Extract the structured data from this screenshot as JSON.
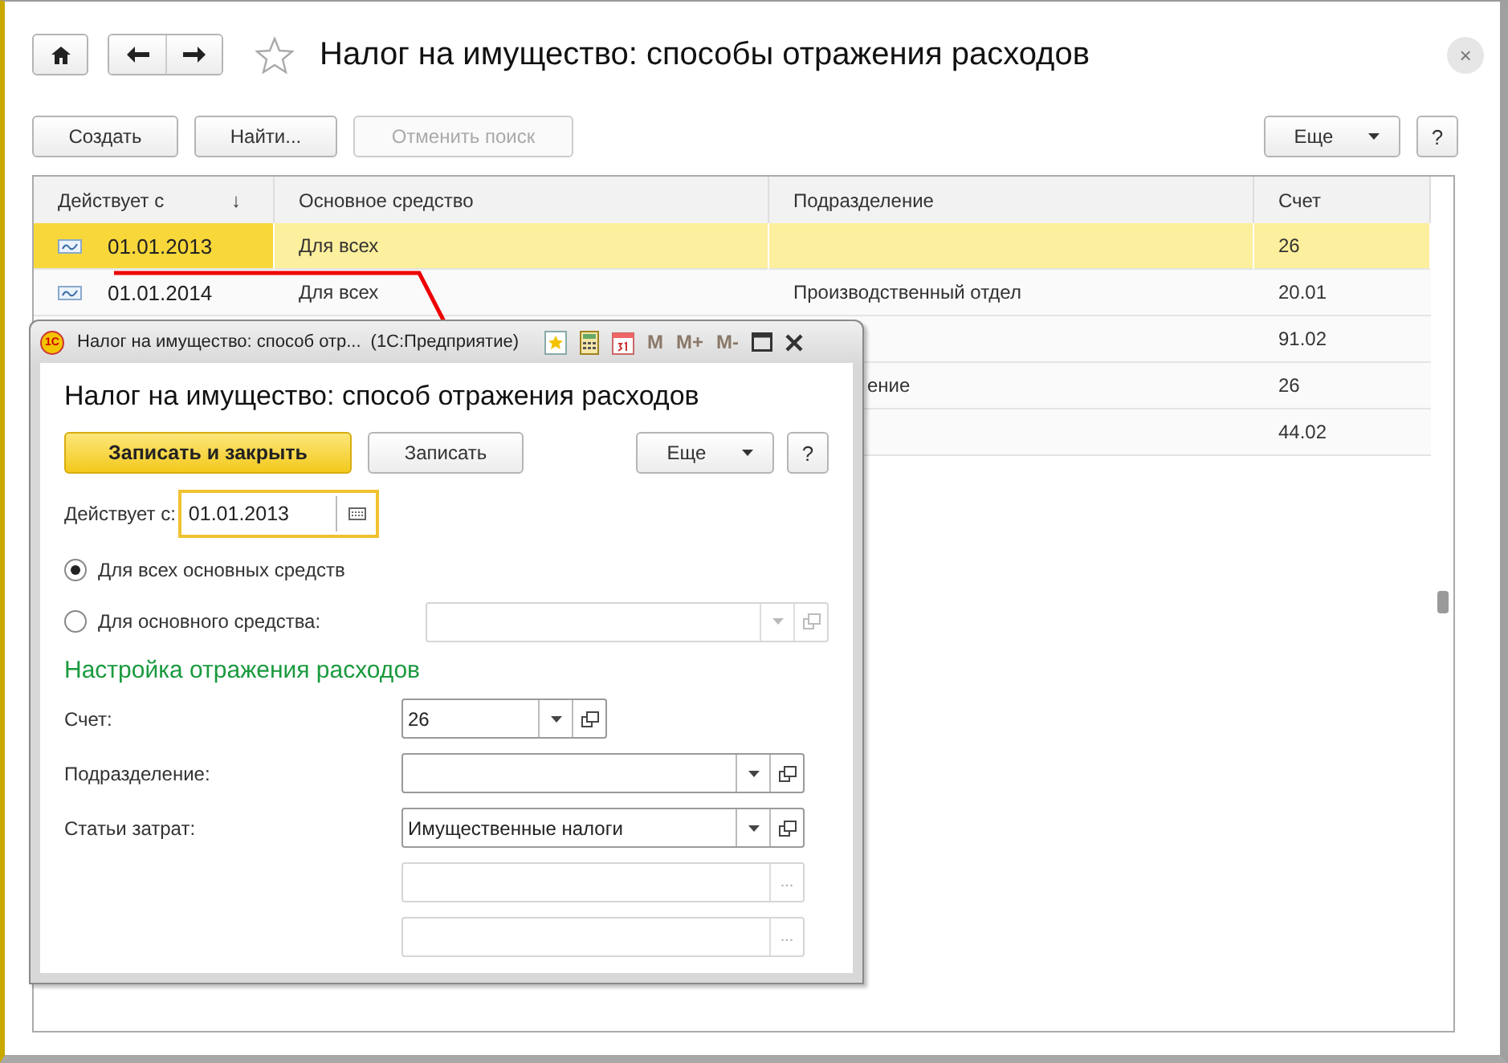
{
  "window": {
    "title": "Налог на имущество: способы отражения расходов",
    "close": "×"
  },
  "toolbar": {
    "buttons": [
      {
        "label": "Создать",
        "disabled": false
      },
      {
        "label": "Найти...",
        "disabled": false
      },
      {
        "label": "Отменить поиск",
        "disabled": true
      }
    ],
    "more": "Еще",
    "help": "?"
  },
  "table": {
    "columns": [
      "Действует с",
      "Основное средство",
      "Подразделение",
      "Счет"
    ],
    "sort_mark": "↓",
    "rows": [
      {
        "selected": true,
        "date": "01.01.2013",
        "asset": "Для всех",
        "account": "26"
      },
      {
        "selected": false,
        "date": "01.01.2014",
        "asset": "Для всех",
        "subdivision": "Производственный отдел",
        "account": "20.01"
      },
      {
        "selected": false,
        "account": "91.02"
      },
      {
        "selected": false,
        "subdivision": "ение",
        "subdivision_partly_hidden": true,
        "account": "26"
      },
      {
        "selected": false,
        "account": "44.02"
      }
    ]
  },
  "dialog": {
    "logo": "1С",
    "title": "Налог на имущество: способ отр...",
    "app": "(1С:Предприятие)",
    "memory_buttons": [
      "M",
      "M+",
      "M-"
    ],
    "heading": "Налог на имущество: способ отражения расходов",
    "buttons": [
      {
        "label": "Записать и закрыть",
        "kind": "primary"
      },
      {
        "label": "Записать",
        "kind": "plain"
      }
    ],
    "more": "Еще",
    "help": "?",
    "date_label": "Действует с:",
    "date_value": "01.01.2013",
    "radios": [
      {
        "label": "Для всех основных средств",
        "selected": true
      },
      {
        "label": "Для основного средства:",
        "selected": false
      }
    ],
    "section": "Настройка отражения расходов",
    "fields": [
      {
        "kind": "choice",
        "label": "Счет:",
        "value": "26",
        "narrow": true
      },
      {
        "kind": "choice",
        "label": "Подразделение:",
        "narrow": false
      },
      {
        "kind": "choice",
        "label": "Статьи затрат:",
        "value": "Имущественные налоги",
        "narrow": false
      },
      {
        "kind": "extra",
        "button": "..."
      },
      {
        "kind": "extra",
        "button": "..."
      }
    ]
  }
}
